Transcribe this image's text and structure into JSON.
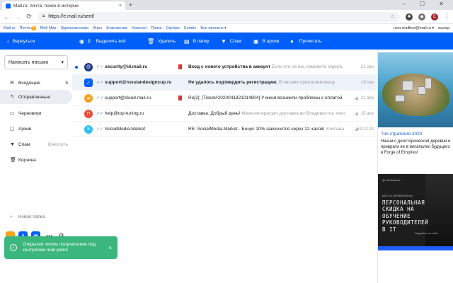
{
  "browser": {
    "tab_title": "Mail.ru: почта, поиск в интерне",
    "tab_close": "×",
    "new_tab": "+",
    "window_controls": "– ☐ ✕",
    "url": "https://e.mail.ru/sent/",
    "profile_letter": "C"
  },
  "portal": {
    "items": [
      "Mail.ru",
      "Почта",
      "Мой Мир",
      "Одноклассники",
      "Игры",
      "Знакомства",
      "Новости",
      "Поиск",
      "Смотри",
      "Combo",
      "Все проекты"
    ],
    "mail_badge": "6",
    "user": "user.mailbox@mail.ru",
    "logout": "выход"
  },
  "toolbar": {
    "back": "Вернуться",
    "selected_count": "2",
    "select_all": "Выделить всё",
    "delete": "Удалить",
    "to_folder": "В папку",
    "spam": "Спам",
    "archive": "В архив",
    "mark_read": "Прочитать"
  },
  "sidebar": {
    "compose": "Написать письмо",
    "folders": [
      {
        "label": "Входящие",
        "count": "5"
      },
      {
        "label": "Отправленные",
        "count": ""
      },
      {
        "label": "Черновики",
        "count": ""
      },
      {
        "label": "Архив",
        "count": ""
      },
      {
        "label": "Спам",
        "action": "Очистить"
      },
      {
        "label": "Корзина",
        "count": ""
      }
    ],
    "new_folder": "Новая папка"
  },
  "messages": [
    {
      "from": "security@id.mail.ru",
      "subject": "Вход с нового устройства в аккаунт",
      "snippet": "Если это не вы, измените пароль",
      "date": "21 сен",
      "unread": true,
      "selected": false,
      "avatar_letter": "",
      "avatar_color": "#1e3a8a"
    },
    {
      "from": "support@russiandesigncup.ru",
      "subject": "Не удалось подтвердить регистрацию.",
      "snippet": "В письме прилагаем вашу",
      "date": "18 сен",
      "unread": false,
      "selected": true,
      "avatar_letter": "",
      "avatar_color": "#005ff9"
    },
    {
      "from": "support@cloud.mail.ru",
      "subject": "Re[2]: [Ticket#2020041821014804] У меня возникли проблемы с оплатой",
      "snippet": "",
      "date": "21 апр",
      "unread": false,
      "selected": false,
      "avatar_letter": "",
      "avatar_color": "#f6a21e"
    },
    {
      "from": "help@top-tuning.ru",
      "subject": "Доставка. Добрый день!",
      "snippet": "Меня интересует доставка во Владивосток. чего",
      "date": "15 апр",
      "unread": false,
      "selected": false,
      "avatar_letter": "H",
      "avatar_color": "#ea4c3a"
    },
    {
      "from": "SocialMedia.Market",
      "subject": "RE: SocialMedia.Market - Бонус 10% закончится через 12 часов!",
      "snippet": "Учитыва",
      "date": "14.12.19",
      "unread": false,
      "selected": false,
      "avatar_letter": "S",
      "avatar_color": "#2ec0ef"
    }
  ],
  "ads": {
    "ad1_title": "Топ-стратегия 2020",
    "ad1_text": "Начни с доисторической деревни и преврати ее в мегаполис будущего в Forge of Empires!",
    "ad2_brand": "@ Geekbrains",
    "ad2_tagline": "МЕСТА ОГРАНИЧЕНЫ",
    "ad2_headline": "ПЕРСОНАЛЬНАЯ СКИДКА НА ОБУЧЕНИЕ РУКОВОДИТЕЛЕЙ В IT",
    "ad2_note": "Подробнее на сайте"
  },
  "toast": {
    "text": "Открытие писем получателем под контролем mail patrol",
    "close": "×"
  },
  "colors": {
    "accent": "#005ff9",
    "toast": "#3bb77e",
    "flag": "#e0332d"
  }
}
